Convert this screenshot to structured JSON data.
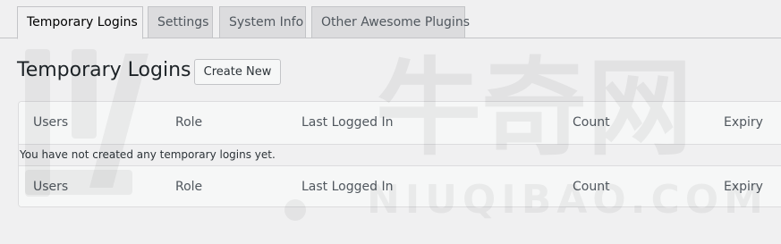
{
  "tabs": [
    {
      "label": "Temporary Logins",
      "active": true
    },
    {
      "label": "Settings",
      "active": false
    },
    {
      "label": "System Info",
      "active": false
    },
    {
      "label": "Other Awesome Plugins",
      "active": false
    }
  ],
  "page": {
    "title": "Temporary Logins",
    "create_button": "Create New"
  },
  "table": {
    "columns": [
      "Users",
      "Role",
      "Last Logged In",
      "Count",
      "Expiry"
    ],
    "empty_message": "You have not created any temporary logins yet."
  },
  "watermark": {
    "text_cn": "牛奇网",
    "text_en": "NIUQIBAO.COM"
  },
  "colors": {
    "background": "#f0f0f1",
    "tab_inactive": "#dcdcde",
    "border": "#c3c4c7",
    "table_header": "#f6f7f7"
  }
}
